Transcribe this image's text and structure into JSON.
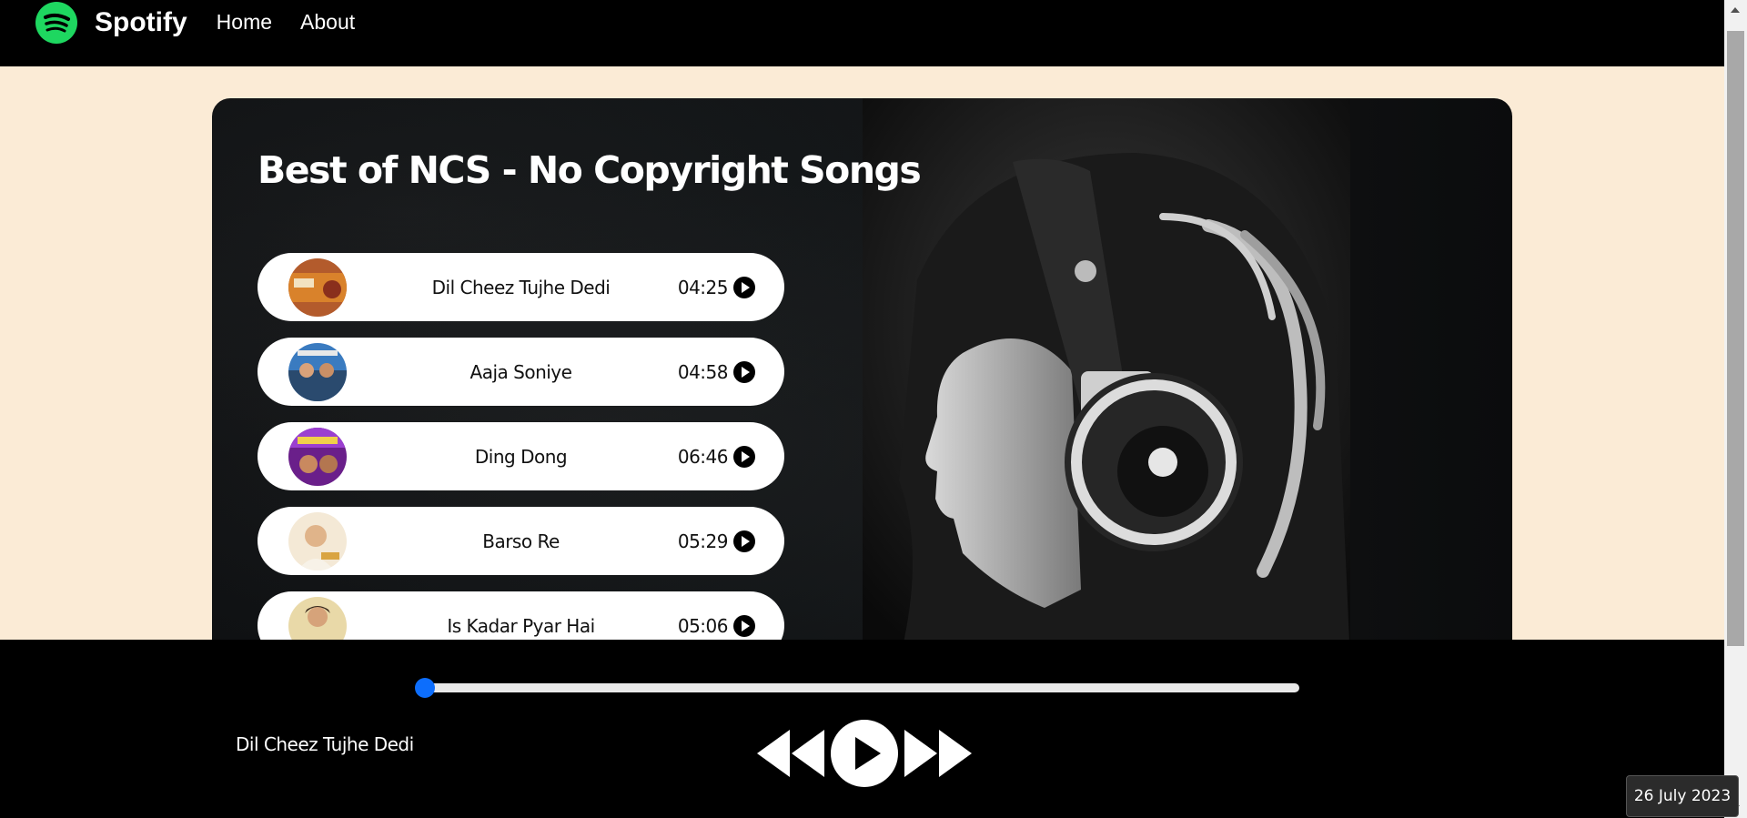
{
  "nav": {
    "brand": "Spotify",
    "links": [
      "Home",
      "About"
    ]
  },
  "icons": {
    "logo": "spotify-logo-icon",
    "play": "play-icon",
    "prev": "previous-icon",
    "next": "next-icon"
  },
  "colors": {
    "brand": "#1ed760",
    "page_background": "#fbebd6",
    "progress_thumb": "#0d6efd"
  },
  "card": {
    "title": "Best of NCS - No Copyright Songs"
  },
  "songs": [
    {
      "name": "Dil Cheez Tujhe Dedi",
      "duration": "04:25"
    },
    {
      "name": "Aaja Soniye",
      "duration": "04:58"
    },
    {
      "name": "Ding Dong",
      "duration": "06:46"
    },
    {
      "name": "Barso Re",
      "duration": "05:29"
    },
    {
      "name": "Is Kadar Pyar Hai",
      "duration": "05:06"
    }
  ],
  "player": {
    "current_song": "Dil Cheez Tujhe Dedi",
    "progress": 0,
    "state": "paused"
  },
  "taskbar": {
    "date": "26 July 2023"
  }
}
